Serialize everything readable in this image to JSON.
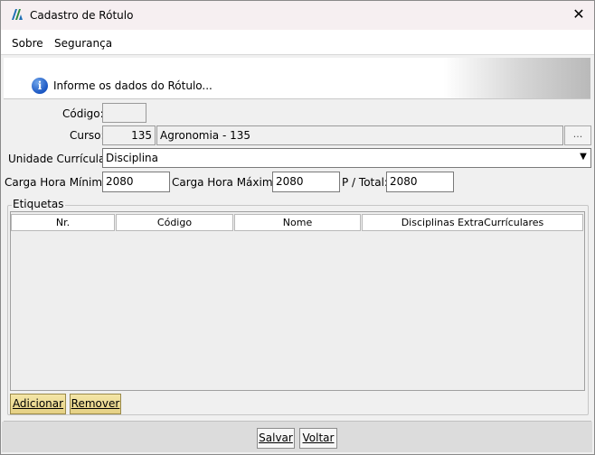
{
  "window": {
    "title": "Cadastro de Rótulo",
    "close_symbol": "✕"
  },
  "menu": [
    {
      "label": "Sobre"
    },
    {
      "label": "Segurança"
    }
  ],
  "banner": {
    "text": "Informe os dados do Rótulo...",
    "icon": "info-icon"
  },
  "form": {
    "codigo_label": "Código:",
    "codigo_value": "",
    "curso_label": "Curso:",
    "curso_code": "135",
    "curso_name": "Agronomia - 135",
    "curso_lookup_label": "...",
    "unidade_label": "Unidade Currícular:",
    "unidade_value": "Disciplina",
    "ch_min_label": "Carga Hora Mínima:",
    "ch_min_value": "2080",
    "ch_max_label": "Carga Hora Máxima:",
    "ch_max_value": "2080",
    "ptotal_label": "P / Total:",
    "ptotal_value": "2080"
  },
  "etiquetas": {
    "title": "Etiquetas",
    "columns": [
      "Nr.",
      "Código",
      "Nome",
      "Disciplinas ExtraCurrículares"
    ],
    "rows": [],
    "add_label": "Adicionar",
    "remove_label": "Remover"
  },
  "footer": {
    "save_label": "Salvar",
    "back_label": "Voltar"
  }
}
